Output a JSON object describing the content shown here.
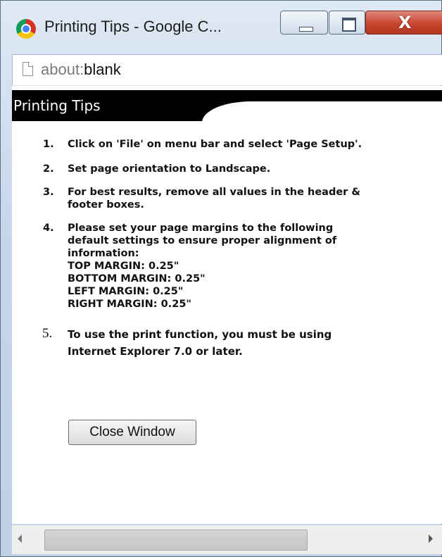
{
  "window": {
    "title": "Printing Tips - Google C...",
    "close_glyph": "X"
  },
  "address_bar": {
    "scheme": "about:",
    "path": "blank"
  },
  "page": {
    "header_title": "Printing Tips",
    "tips": [
      {
        "num": "1.",
        "text": "Click on 'File' on menu bar and select 'Page Setup'."
      },
      {
        "num": "2.",
        "text": "Set page orientation to Landscape."
      },
      {
        "num": "3.",
        "text": "For best results, remove all values in the header &\nfooter boxes."
      },
      {
        "num": "4.",
        "text": "Please set your page margins to the following\ndefault settings to ensure proper alignment of\ninformation:\nTOP MARGIN: 0.25\"\nBOTTOM MARGIN: 0.25\"\nLEFT MARGIN: 0.25\"\nRIGHT MARGIN: 0.25\""
      },
      {
        "num": "5.",
        "text": "To use the print function, you must be using\nInternet Explorer 7.0 or later."
      }
    ],
    "close_button_label": "Close Window"
  },
  "icons": {
    "app": "chrome-icon",
    "page": "page-icon",
    "minimize": "minimize-icon",
    "maximize": "maximize-icon",
    "close": "close-icon",
    "scroll_left": "arrow-left-icon",
    "scroll_right": "arrow-right-icon"
  },
  "colors": {
    "header_bg": "#000000",
    "close_button_bg": "#c7452f"
  }
}
